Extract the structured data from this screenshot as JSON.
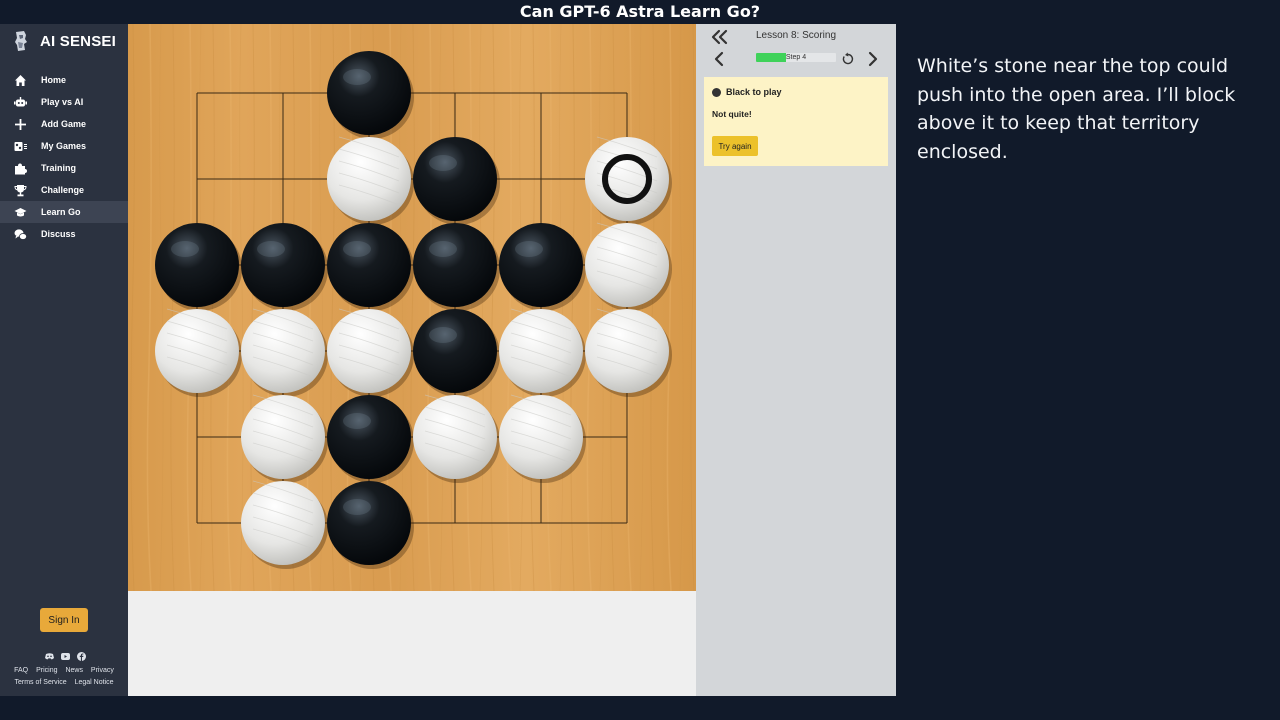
{
  "video": {
    "title": "Can GPT-6 Astra Learn Go?"
  },
  "commentary": "White’s stone near the top could push into the open area. I’ll block above it to keep that territory enclosed.",
  "brand": {
    "name": "AI SENSEI"
  },
  "sidebar": {
    "items": [
      {
        "label": "Home",
        "icon": "home-icon"
      },
      {
        "label": "Play vs AI",
        "icon": "robot-icon"
      },
      {
        "label": "Add Game",
        "icon": "plus-icon"
      },
      {
        "label": "My Games",
        "icon": "games-list-icon"
      },
      {
        "label": "Training",
        "icon": "puzzle-icon"
      },
      {
        "label": "Challenge",
        "icon": "trophy-icon"
      },
      {
        "label": "Learn Go",
        "icon": "graduation-cap-icon",
        "active": true
      },
      {
        "label": "Discuss",
        "icon": "chat-icon"
      }
    ],
    "sign_in": "Sign In",
    "social": [
      "discord-icon",
      "youtube-icon",
      "facebook-icon"
    ],
    "footer": [
      "FAQ",
      "Pricing",
      "News",
      "Privacy",
      "Terms of Service",
      "Legal Notice"
    ]
  },
  "lesson": {
    "title": "Lesson 8: Scoring",
    "step_label": "Step 4",
    "progress": 0.38,
    "to_play": "Black to play",
    "feedback": "Not quite!",
    "try_again": "Try again"
  },
  "board": {
    "size": 6,
    "stones": [
      {
        "color": "black",
        "col": 2,
        "row": 0
      },
      {
        "color": "white",
        "col": 2,
        "row": 1
      },
      {
        "color": "black",
        "col": 3,
        "row": 1
      },
      {
        "color": "white",
        "col": 5,
        "row": 1,
        "marked": true
      },
      {
        "color": "black",
        "col": 0,
        "row": 2
      },
      {
        "color": "black",
        "col": 1,
        "row": 2
      },
      {
        "color": "black",
        "col": 2,
        "row": 2
      },
      {
        "color": "black",
        "col": 3,
        "row": 2
      },
      {
        "color": "black",
        "col": 4,
        "row": 2
      },
      {
        "color": "white",
        "col": 5,
        "row": 2
      },
      {
        "color": "white",
        "col": 0,
        "row": 3
      },
      {
        "color": "white",
        "col": 1,
        "row": 3
      },
      {
        "color": "white",
        "col": 2,
        "row": 3
      },
      {
        "color": "black",
        "col": 3,
        "row": 3
      },
      {
        "color": "white",
        "col": 4,
        "row": 3
      },
      {
        "color": "white",
        "col": 5,
        "row": 3
      },
      {
        "color": "white",
        "col": 1,
        "row": 4
      },
      {
        "color": "black",
        "col": 2,
        "row": 4
      },
      {
        "color": "white",
        "col": 3,
        "row": 4
      },
      {
        "color": "white",
        "col": 4,
        "row": 4
      },
      {
        "color": "white",
        "col": 1,
        "row": 5
      },
      {
        "color": "black",
        "col": 2,
        "row": 5
      }
    ]
  },
  "colors": {
    "sidebar_bg": "#2b3240",
    "board_wood": "#dca155",
    "accent_yellow": "#ecc12b",
    "progress_green": "#3fd25a",
    "message_bg": "#fdf3c6"
  }
}
